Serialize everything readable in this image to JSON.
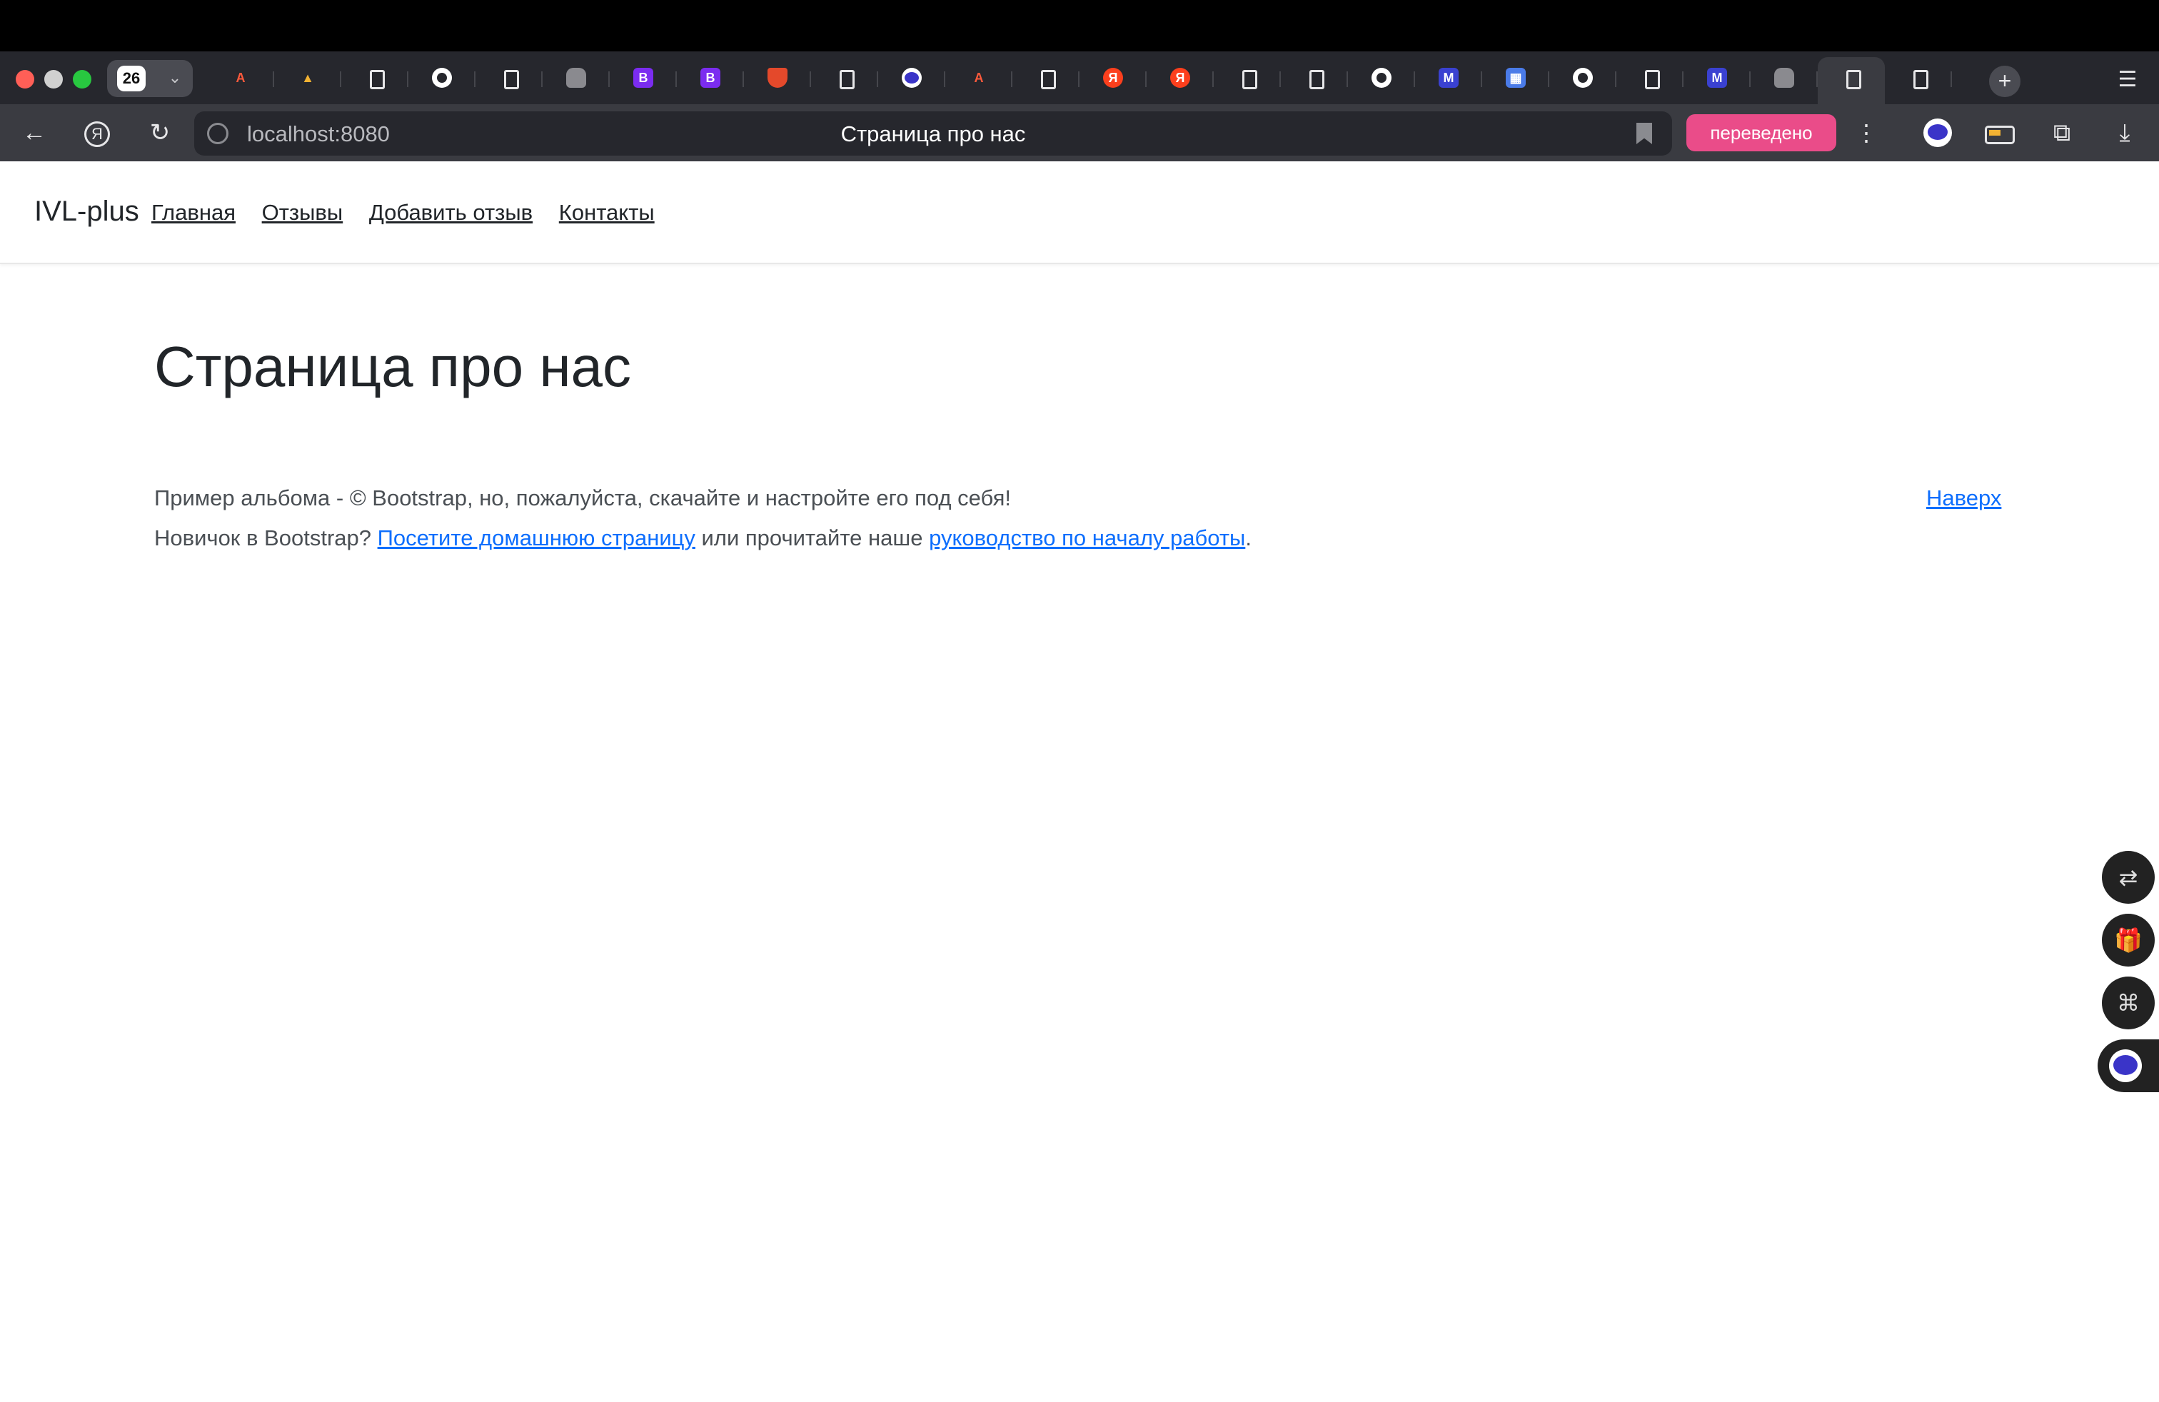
{
  "browser": {
    "tab_count": "26",
    "url": "localhost:8080",
    "title": "Страница про нас",
    "translate_badge": "переведено",
    "tabs": [
      {
        "icon": "translate-icon",
        "glyph": "A"
      },
      {
        "icon": "triangle-logo-icon",
        "glyph": "▲"
      },
      {
        "icon": "page-icon",
        "glyph": ""
      },
      {
        "icon": "github-icon",
        "glyph": ""
      },
      {
        "icon": "page-icon",
        "glyph": ""
      },
      {
        "icon": "elephant-icon",
        "glyph": ""
      },
      {
        "icon": "bootstrap-icon",
        "glyph": "B"
      },
      {
        "icon": "bootstrap-icon",
        "glyph": "B"
      },
      {
        "icon": "shield-icon",
        "glyph": ""
      },
      {
        "icon": "page-icon",
        "glyph": ""
      },
      {
        "icon": "alice-icon",
        "glyph": ""
      },
      {
        "icon": "translate-icon",
        "glyph": "A"
      },
      {
        "icon": "page-icon",
        "glyph": ""
      },
      {
        "icon": "yandex-icon",
        "glyph": "Я"
      },
      {
        "icon": "yandex-icon",
        "glyph": "Я"
      },
      {
        "icon": "page-icon",
        "glyph": ""
      },
      {
        "icon": "page-icon",
        "glyph": ""
      },
      {
        "icon": "github-icon",
        "glyph": ""
      },
      {
        "icon": "m-logo-icon",
        "glyph": "M"
      },
      {
        "icon": "chart-icon",
        "glyph": "▦"
      },
      {
        "icon": "github-icon",
        "glyph": ""
      },
      {
        "icon": "page-icon",
        "glyph": ""
      },
      {
        "icon": "m-logo-icon",
        "glyph": "M"
      },
      {
        "icon": "elephant-icon",
        "glyph": ""
      },
      {
        "icon": "page-icon",
        "glyph": "",
        "active": true
      },
      {
        "icon": "page-icon",
        "glyph": ""
      }
    ]
  },
  "navbar": {
    "brand": "IVL-plus",
    "links": [
      "Главная",
      "Отзывы",
      "Добавить отзыв",
      "Контакты"
    ]
  },
  "main": {
    "heading": "Страница про нас"
  },
  "footer": {
    "line1": "Пример альбома - © Bootstrap, но, пожалуйста, скачайте и настройте его под себя!",
    "to_top": "Наверх",
    "line2_prefix": "Новичок в Bootstrap? ",
    "line2_link1": "Посетите домашнюю страницу",
    "line2_middle": " или прочитайте наше ",
    "line2_link2": "руководство по началу работы",
    "line2_suffix": "."
  },
  "floating": {
    "translate_icon": "⇄",
    "gift_icon": "🎁",
    "apps_icon": "⌘"
  }
}
